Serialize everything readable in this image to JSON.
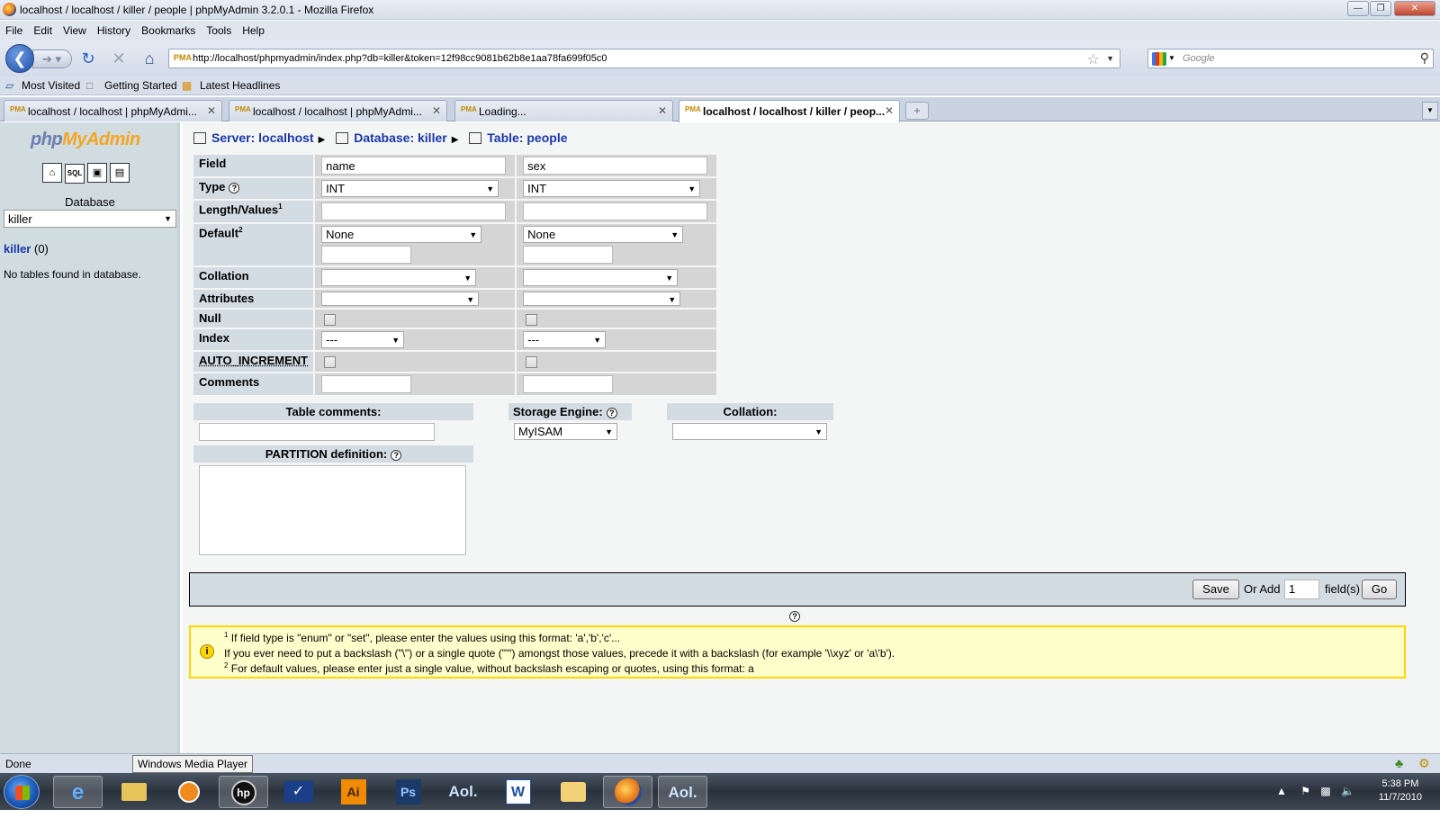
{
  "window": {
    "title": "localhost / localhost / killer / people | phpMyAdmin 3.2.0.1 - Mozilla Firefox"
  },
  "menu": [
    "File",
    "Edit",
    "View",
    "History",
    "Bookmarks",
    "Tools",
    "Help"
  ],
  "nav": {
    "url": "http://localhost/phpmyadmin/index.php?db=killer&token=12f98cc9081b62b8e1aa78fa699f05c0",
    "search_placeholder": "Google",
    "favicon_text": "PMA"
  },
  "bookmarks": [
    "Most Visited",
    "Getting Started",
    "Latest Headlines"
  ],
  "tabs": [
    {
      "label": "localhost / localhost | phpMyAdmi...",
      "active": false
    },
    {
      "label": "localhost / localhost | phpMyAdmi...",
      "active": false
    },
    {
      "label": "Loading...",
      "active": false
    },
    {
      "label": "localhost / localhost / killer / peop...",
      "active": true
    }
  ],
  "left": {
    "logo": {
      "php": "php",
      "my": "My",
      "admin": "Admin"
    },
    "icons": [
      "home-icon",
      "sql-query-icon",
      "query-window-icon",
      "docs-icon"
    ],
    "database_label": "Database",
    "database_selected": "killer",
    "db_link": "killer",
    "db_count": "(0)",
    "no_tables": "No tables found in database."
  },
  "breadcrumb": {
    "server": "Server: localhost",
    "database": "Database: killer",
    "table": "Table: people"
  },
  "field_table": {
    "labels": {
      "field": "Field",
      "type": "Type",
      "length": "Length/Values",
      "length_sup": "1",
      "default": "Default",
      "default_sup": "2",
      "collation": "Collation",
      "attributes": "Attributes",
      "null": "Null",
      "index": "Index",
      "auto_increment": "AUTO_INCREMENT",
      "comments": "Comments"
    },
    "columns": [
      {
        "name": "name",
        "type": "INT",
        "length": "",
        "default": "None",
        "default_value": "",
        "collation": "",
        "attributes": "",
        "null": false,
        "index": "---",
        "auto_increment": false,
        "comment": ""
      },
      {
        "name": "sex",
        "type": "INT",
        "length": "",
        "default": "None",
        "default_value": "",
        "collation": "",
        "attributes": "",
        "null": false,
        "index": "---",
        "auto_increment": false,
        "comment": ""
      }
    ]
  },
  "table_options": {
    "comments_label": "Table comments:",
    "comments_value": "",
    "engine_label": "Storage Engine:",
    "engine_value": "MyISAM",
    "collation_label": "Collation:",
    "collation_value": "",
    "partition_label": "PARTITION definition:",
    "partition_value": ""
  },
  "actions": {
    "save": "Save",
    "or_add": "Or Add",
    "add_count": "1",
    "fields_suffix": "field(s)",
    "go": "Go"
  },
  "notice": {
    "line1_sup": "1",
    "line1": "If field type is \"enum\" or \"set\", please enter the values using this format: 'a','b','c'...",
    "line2": "If you ever need to put a backslash (\"\\\") or a single quote (\"'\") amongst those values, precede it with a backslash (for example '\\\\xyz' or 'a\\'b').",
    "line3_sup": "2",
    "line3": "For default values, please enter just a single value, without backslash escaping or quotes, using this format: a"
  },
  "status": {
    "text": "Done",
    "tooltip": "Windows Media Player"
  },
  "taskbar": {
    "apps": [
      "internet-explorer",
      "windows-explorer",
      "media-player",
      "hp",
      "checkmark-app",
      "illustrator",
      "photoshop",
      "aol",
      "word",
      "outlook",
      "firefox",
      "aol-desktop"
    ],
    "app_text": {
      "ai": "Ai",
      "ps": "Ps",
      "aol": "Aol.",
      "aol2": "Aol."
    },
    "time": "5:38 PM",
    "date": "11/7/2010"
  },
  "colors": {
    "link": "#1a37a8",
    "header_bg": "#d3dce3",
    "cell_bg": "#d5d5d5",
    "notice_bg": "#ffffcc",
    "notice_border": "#ffd700",
    "left_bg": "#d0dce0"
  }
}
